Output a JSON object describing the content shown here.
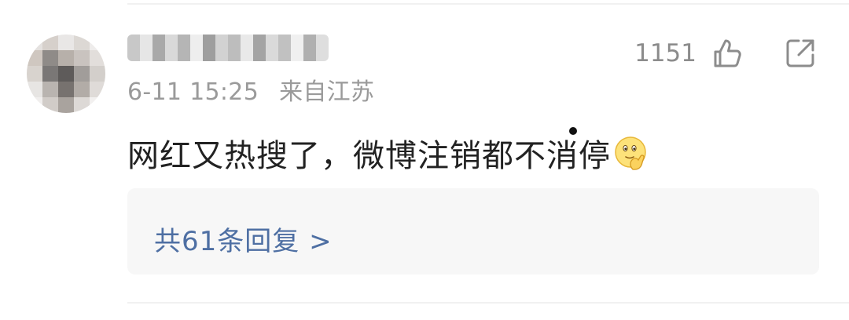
{
  "comment": {
    "username": "",
    "timestamp": "6-11 15:25",
    "source": "来自江苏",
    "like_count": "1151",
    "text": "网红又热搜了，微博注销都不消停",
    "emoji": "smirk-face-emoji",
    "replies_label": "共61条回复 >"
  },
  "icons": {
    "like": "thumbs-up-icon",
    "share": "share-icon"
  },
  "colors": {
    "link": "#4e6fa3",
    "meta": "#9a9a9a",
    "text": "#222222",
    "reply_bg": "#f7f7f7"
  }
}
